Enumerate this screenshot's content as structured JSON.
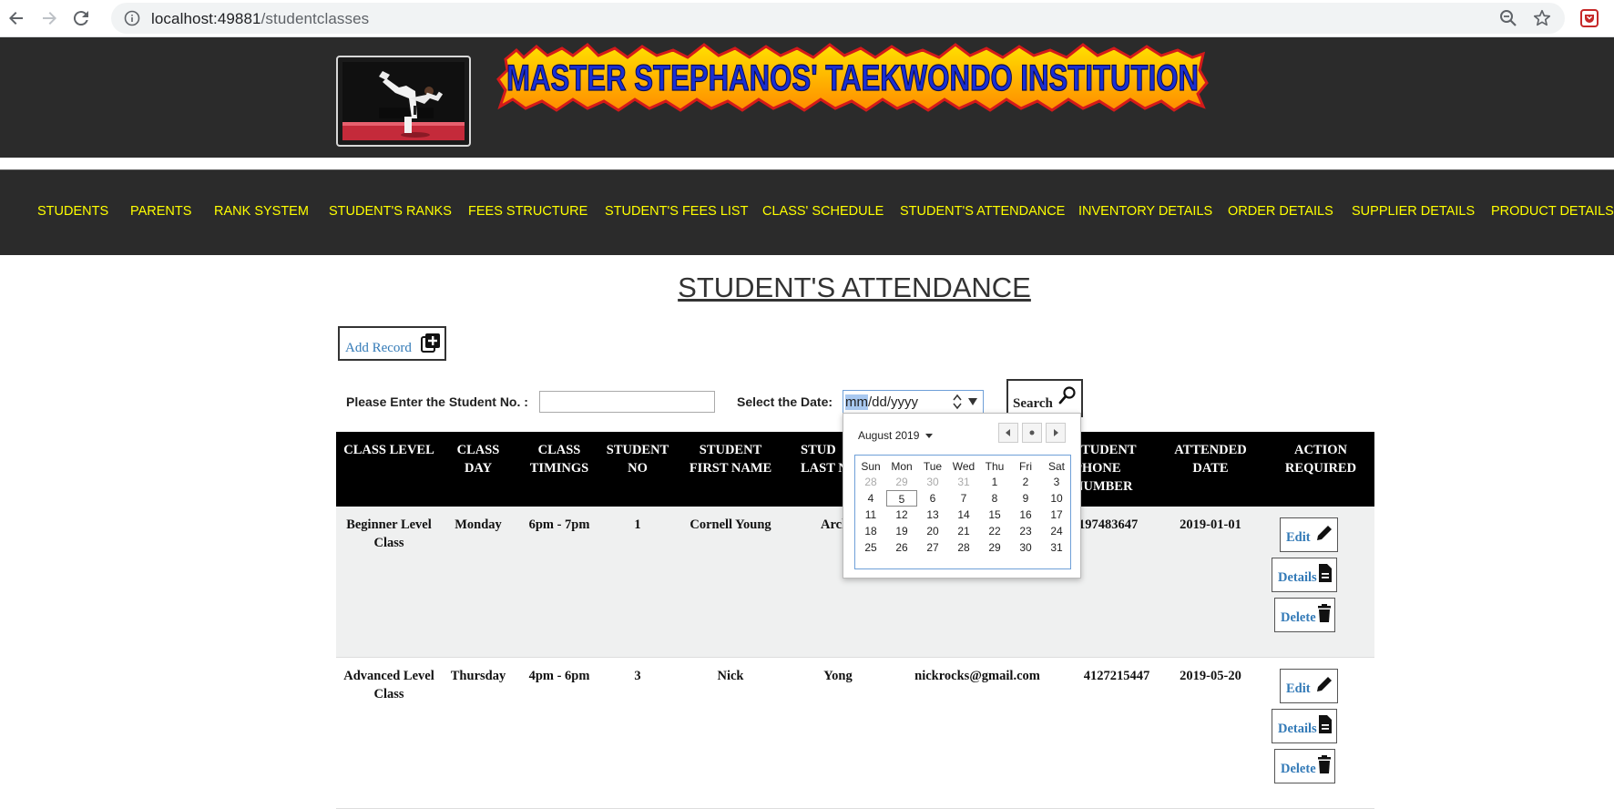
{
  "browser": {
    "url_host": "localhost:49881",
    "url_path": "/studentclasses"
  },
  "header": {
    "banner_text": "MASTER STEPHANOS' TAEKWONDO INSTITUTION"
  },
  "nav": {
    "items": [
      "STUDENTS",
      "PARENTS",
      "RANK SYSTEM",
      "STUDENT'S RANKS",
      "FEES STRUCTURE",
      "STUDENT'S FEES LIST",
      "CLASS' SCHEDULE",
      "STUDENT'S ATTENDANCE",
      "INVENTORY DETAILS",
      "ORDER DETAILS",
      "SUPPLIER DETAILS",
      "PRODUCT DETAILS"
    ]
  },
  "page": {
    "title": "STUDENT'S ATTENDANCE",
    "add_record": "Add Record",
    "student_no_label": "Please Enter the Student No. :",
    "student_no_value": "",
    "date_label": "Select the Date:",
    "date_placeholder_mm": "mm",
    "date_placeholder_rest": "/dd/yyyy",
    "search_label": "Search"
  },
  "table": {
    "headers": [
      [
        "CLASS LEVEL"
      ],
      [
        "CLASS",
        "DAY"
      ],
      [
        "CLASS",
        "TIMINGS"
      ],
      [
        "STUDENT",
        "NO"
      ],
      [
        "STUDENT",
        "FIRST NAME"
      ],
      [
        "STUD",
        "LAST N"
      ],
      [],
      [
        "STUDENT",
        "PHONE",
        "NUMBER"
      ],
      [
        "ATTENDED",
        "DATE"
      ],
      [
        "ACTION",
        "REQUIRED"
      ]
    ],
    "rows": [
      {
        "class_level": [
          "Beginner Level",
          "Class"
        ],
        "class_day": "Monday",
        "class_timings": "6pm - 7pm",
        "student_no": "1",
        "first_name": "Cornell Young",
        "last_name": "Arcl",
        "email": "",
        "phone": "197483647",
        "attended_date": "2019-01-01"
      },
      {
        "class_level": [
          "Advanced Level",
          "Class"
        ],
        "class_day": "Thursday",
        "class_timings": "4pm - 6pm",
        "student_no": "3",
        "first_name": "Nick",
        "last_name": "Yong",
        "email": "nickrocks@gmail.com",
        "phone": "4127215447",
        "attended_date": "2019-05-20"
      }
    ],
    "actions": {
      "edit": "Edit",
      "details": "Details",
      "delete": "Delete"
    }
  },
  "calendar": {
    "month_label": "August 2019",
    "weekdays": [
      "Sun",
      "Mon",
      "Tue",
      "Wed",
      "Thu",
      "Fri",
      "Sat"
    ],
    "weeks": [
      [
        "28",
        "29",
        "30",
        "31",
        "1",
        "2",
        "3"
      ],
      [
        "4",
        "5",
        "6",
        "7",
        "8",
        "9",
        "10"
      ],
      [
        "11",
        "12",
        "13",
        "14",
        "15",
        "16",
        "17"
      ],
      [
        "18",
        "19",
        "20",
        "21",
        "22",
        "23",
        "24"
      ],
      [
        "25",
        "26",
        "27",
        "28",
        "29",
        "30",
        "31"
      ]
    ],
    "other_month_cells": [
      "0-0",
      "0-1",
      "0-2",
      "0-3"
    ],
    "today_cell": "1-1"
  },
  "colors": {
    "nav_text": "#ffff00",
    "header_bg": "#2b2b2b",
    "link_blue": "#337ab7",
    "table_head_bg": "#000000",
    "row_alt_bg": "#eff0f0"
  }
}
